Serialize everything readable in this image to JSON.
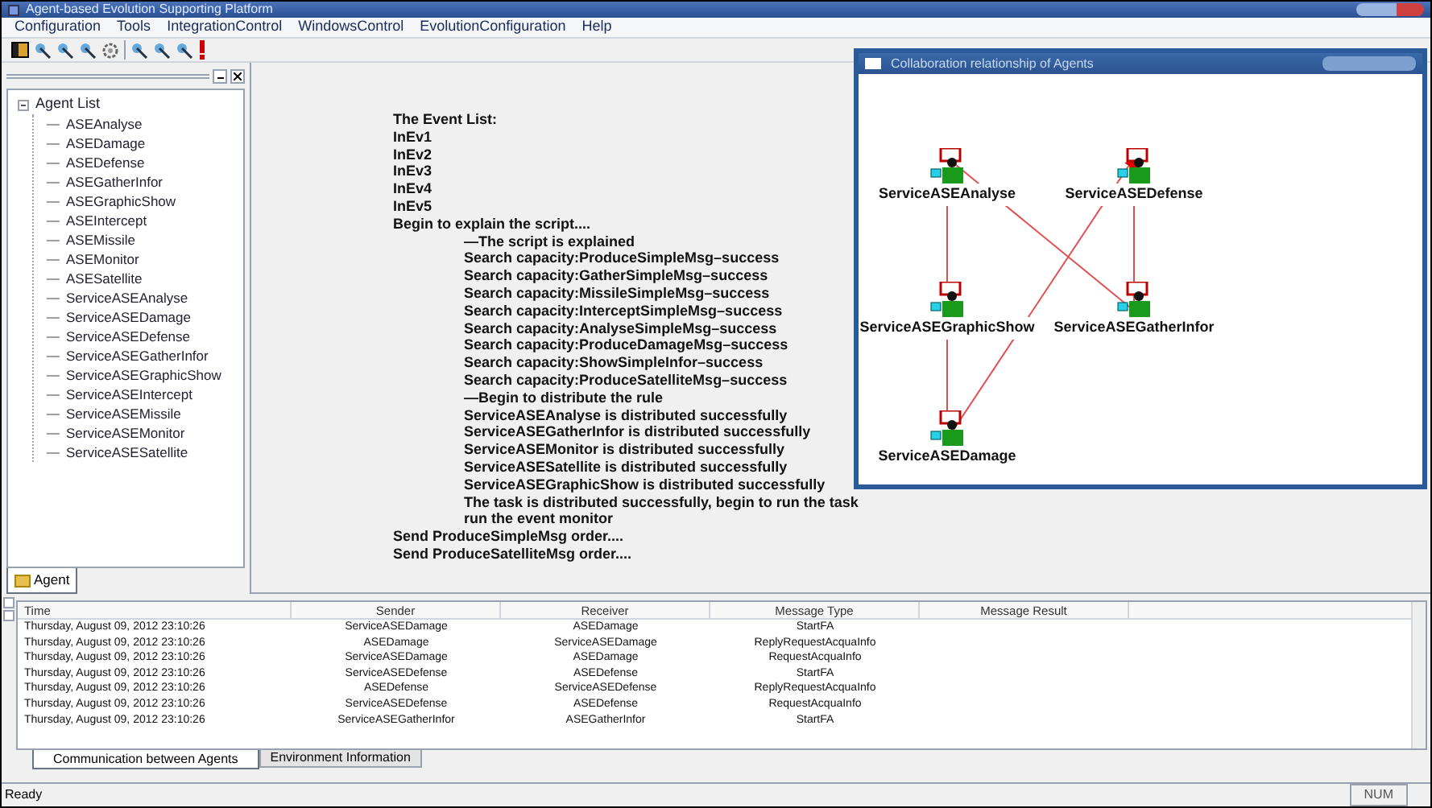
{
  "window": {
    "title": "Agent-based Evolution Supporting Platform"
  },
  "menu": [
    "Configuration",
    "Tools",
    "IntegrationControl",
    "WindowsControl",
    "EvolutionConfiguration",
    "Help"
  ],
  "tree": {
    "label": "Agent List",
    "expanded": true,
    "children": [
      {
        "label": "ASEAnalyse"
      },
      {
        "label": "ASEDamage"
      },
      {
        "label": "ASEDefense"
      },
      {
        "label": "ASEGatherInfor"
      },
      {
        "label": "ASEGraphicShow"
      },
      {
        "label": "ASEIntercept"
      },
      {
        "label": "ASEMissile"
      },
      {
        "label": "ASEMonitor"
      },
      {
        "label": "ASESatellite"
      },
      {
        "label": "ServiceASEAnalyse"
      },
      {
        "label": "ServiceASEDamage"
      },
      {
        "label": "ServiceASEDefense"
      },
      {
        "label": "ServiceASEGatherInfor"
      },
      {
        "label": "ServiceASEGraphicShow"
      },
      {
        "label": "ServiceASEIntercept"
      },
      {
        "label": "ServiceASEMissile"
      },
      {
        "label": "ServiceASEMonitor"
      },
      {
        "label": "ServiceASESatellite"
      }
    ]
  },
  "left_tabs": [
    {
      "label": "Agent",
      "selected": true
    }
  ],
  "script": [
    {
      "text": "The Event List:"
    },
    {
      "text": "InEv1"
    },
    {
      "text": "InEv2"
    },
    {
      "text": "InEv3"
    },
    {
      "text": "InEv4"
    },
    {
      "text": "InEv5"
    },
    {
      "text": "Begin to explain the script....",
      "children": [
        {
          "text": "—The script is explained"
        },
        {
          "text": "Search capacity:ProduceSimpleMsg–success"
        },
        {
          "text": "Search capacity:GatherSimpleMsg–success"
        },
        {
          "text": "Search capacity:MissileSimpleMsg–success"
        },
        {
          "text": "Search capacity:InterceptSimpleMsg–success"
        },
        {
          "text": "Search capacity:AnalyseSimpleMsg–success"
        },
        {
          "text": "Search capacity:ProduceDamageMsg–success"
        },
        {
          "text": "Search capacity:ShowSimpleInfor–success"
        },
        {
          "text": "Search capacity:ProduceSatelliteMsg–success"
        },
        {
          "text": "—Begin to distribute the rule"
        },
        {
          "text": "ServiceASEAnalyse is distributed successfully"
        },
        {
          "text": "ServiceASEGatherInfor is distributed successfully"
        },
        {
          "text": "ServiceASEMonitor is distributed successfully"
        },
        {
          "text": "ServiceASESatellite is distributed successfully"
        },
        {
          "text": "ServiceASEGraphicShow is distributed successfully"
        },
        {
          "text": "The task is distributed successfully,  begin to run the task"
        },
        {
          "text": "run the event monitor"
        }
      ]
    },
    {
      "text": "Send ProduceSimpleMsg order...."
    },
    {
      "text": "Send ProduceSatelliteMsg order...."
    }
  ],
  "graph_window": {
    "title": "Collaboration relationship of Agents",
    "nodes": [
      {
        "label": "ServiceASEAnalyse"
      },
      {
        "label": "ServiceASEDefense"
      },
      {
        "label": "ServiceASEGraphicShow"
      },
      {
        "label": "ServiceASEGatherInfor"
      },
      {
        "label": "ServiceASEDamage"
      }
    ]
  },
  "table": {
    "columns": [
      "Time",
      "Sender",
      "Receiver",
      "Message Type",
      "Message Result"
    ],
    "rows": [
      [
        "Thursday, August 09, 2012 23:10:26",
        "ServiceASEDamage",
        "ASEDamage",
        "StartFA"
      ],
      [
        "Thursday, August 09, 2012 23:10:26",
        "ASEDamage",
        "ServiceASEDamage",
        "ReplyRequestAcquaInfo"
      ],
      [
        "Thursday, August 09, 2012 23:10:26",
        "ServiceASEDamage",
        "ASEDamage",
        "RequestAcquaInfo"
      ],
      [
        "Thursday, August 09, 2012 23:10:26",
        "ServiceASEDefense",
        "ASEDefense",
        "StartFA"
      ],
      [
        "Thursday, August 09, 2012 23:10:26",
        "ASEDefense",
        "ServiceASEDefense",
        "ReplyRequestAcquaInfo"
      ],
      [
        "Thursday, August 09, 2012 23:10:26",
        "ServiceASEDefense",
        "ASEDefense",
        "RequestAcquaInfo"
      ],
      [
        "Thursday, August 09, 2012 23:10:26",
        "ServiceASEGatherInfor",
        "ASEGatherInfor",
        "StartFA"
      ]
    ]
  },
  "bottom_tabs": [
    {
      "label": "Communication between Agents",
      "selected": true
    },
    {
      "label": "Environment Information",
      "selected": false
    }
  ],
  "status_bar": {
    "text": "Ready",
    "indicator": "NUM"
  }
}
